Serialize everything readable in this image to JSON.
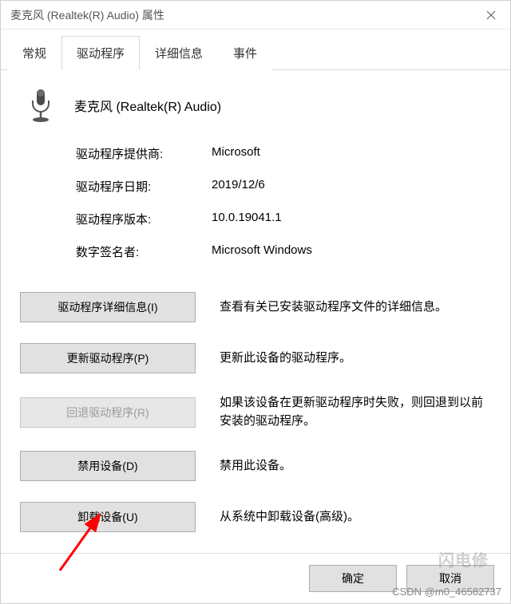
{
  "window": {
    "title": "麦克风 (Realtek(R) Audio) 属性"
  },
  "tabs": {
    "general": "常规",
    "driver": "驱动程序",
    "details": "详细信息",
    "events": "事件"
  },
  "device": {
    "name": "麦克风 (Realtek(R) Audio)"
  },
  "info": {
    "provider_label": "驱动程序提供商:",
    "provider_value": "Microsoft",
    "date_label": "驱动程序日期:",
    "date_value": "2019/12/6",
    "version_label": "驱动程序版本:",
    "version_value": "10.0.19041.1",
    "signer_label": "数字签名者:",
    "signer_value": "Microsoft Windows"
  },
  "actions": {
    "details_btn": "驱动程序详细信息(I)",
    "details_desc": "查看有关已安装驱动程序文件的详细信息。",
    "update_btn": "更新驱动程序(P)",
    "update_desc": "更新此设备的驱动程序。",
    "rollback_btn": "回退驱动程序(R)",
    "rollback_desc": "如果该设备在更新驱动程序时失败，则回退到以前安装的驱动程序。",
    "disable_btn": "禁用设备(D)",
    "disable_desc": "禁用此设备。",
    "uninstall_btn": "卸载设备(U)",
    "uninstall_desc": "从系统中卸载设备(高级)。"
  },
  "footer": {
    "ok": "确定",
    "cancel": "取消"
  },
  "watermark": {
    "brand": "闪电修",
    "csdn": "CSDN @m0_46582737"
  }
}
